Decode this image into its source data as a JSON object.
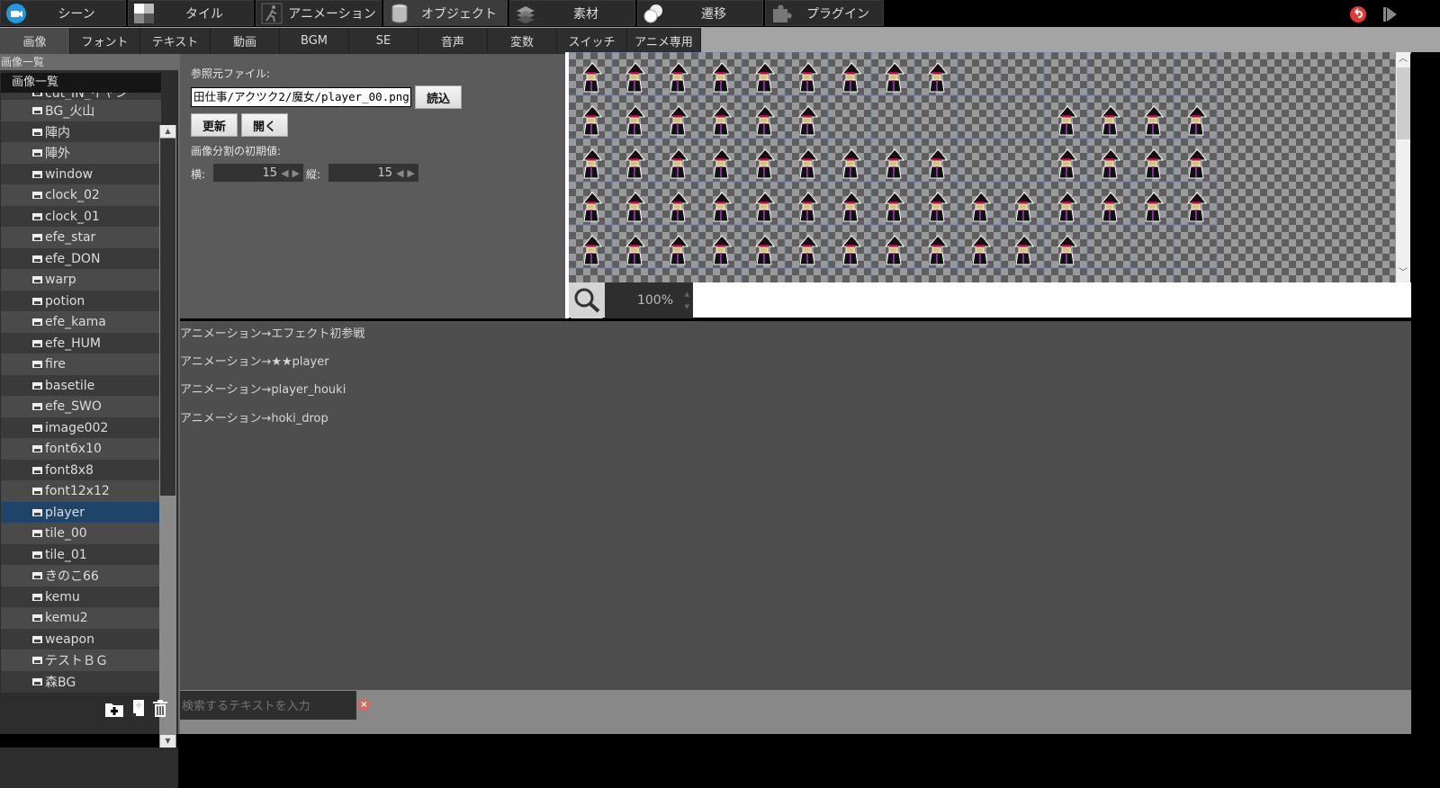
{
  "top_bar": {
    "modes": [
      {
        "label": "シーン",
        "icon": "scene-camera-icon",
        "active": false
      },
      {
        "label": "タイル",
        "icon": "tile-icon",
        "active": false
      },
      {
        "label": "アニメーション",
        "icon": "animation-runner-icon",
        "active": false
      },
      {
        "label": "オブジェクト",
        "icon": "object-cylinder-icon",
        "active": true
      },
      {
        "label": "素材",
        "icon": "resource-layers-icon",
        "active": false
      },
      {
        "label": "遷移",
        "icon": "transition-icon",
        "active": false
      },
      {
        "label": "プラグイン",
        "icon": "plugin-puzzle-icon",
        "active": false
      }
    ],
    "right_icons": [
      "undo-icon",
      "play-icon"
    ],
    "accent_color": "#e53935"
  },
  "tabs": [
    {
      "label": "画像",
      "active": true
    },
    {
      "label": "フォント"
    },
    {
      "label": "テキスト"
    },
    {
      "label": "動画"
    },
    {
      "label": "BGM"
    },
    {
      "label": "SE"
    },
    {
      "label": "音声"
    },
    {
      "label": "変数"
    },
    {
      "label": "スイッチ"
    },
    {
      "label": "アニメ専用"
    }
  ],
  "sidebar": {
    "header": "画像一覧",
    "tree_root": "画像一覧",
    "partial_top_item": "cut_IN_イヤン",
    "items": [
      "BG_火山",
      "陣内",
      "陣外",
      "window",
      "clock_02",
      "clock_01",
      "efe_star",
      "efe_DON",
      "warp",
      "potion",
      "efe_kama",
      "efe_HUM",
      "fire",
      "basetile",
      "efe_SWO",
      "image002",
      "font6x10",
      "font8x8",
      "font12x12",
      "player",
      "tile_00",
      "tile_01",
      "きのこ66",
      "kemu",
      "kemu2",
      "weapon",
      "テストＢＧ",
      "森BG"
    ],
    "selected": "player",
    "selected_color": "#1e4569",
    "footer_icons": [
      "add-folder-icon",
      "add-file-icon",
      "trash-icon"
    ]
  },
  "properties": {
    "source_file_label": "参照元ファイル:",
    "source_file_value": "田仕事/アクツク2/魔女/player_00.png",
    "load_button": "読込",
    "refresh_button": "更新",
    "open_button": "開く",
    "split_label": "画像分割の初期値:",
    "horizontal_label": "横:",
    "horizontal_value": "15",
    "vertical_label": "縦:",
    "vertical_value": "15"
  },
  "viewer": {
    "zoom_value": "100%",
    "sprite_rows": [
      [
        0,
        1,
        2,
        3,
        4,
        5,
        6,
        7,
        8
      ],
      [
        0,
        1,
        2,
        3,
        4,
        5,
        11,
        12,
        13,
        14
      ],
      [
        0,
        1,
        2,
        3,
        4,
        5,
        6,
        7,
        8,
        11,
        12,
        13,
        14
      ],
      [
        0,
        1,
        2,
        3,
        4,
        5,
        6,
        7,
        8,
        9,
        10,
        11,
        12,
        13,
        14
      ],
      [
        0,
        1,
        2,
        3,
        4,
        5,
        6,
        7,
        8,
        9,
        10,
        11
      ]
    ]
  },
  "usage": {
    "items": [
      "アニメーション→エフェクト初参戦",
      "アニメーション→★★player",
      "アニメーション→player_houki",
      "アニメーション→hoki_drop"
    ]
  },
  "search": {
    "placeholder": "検索するテキストを入力"
  }
}
